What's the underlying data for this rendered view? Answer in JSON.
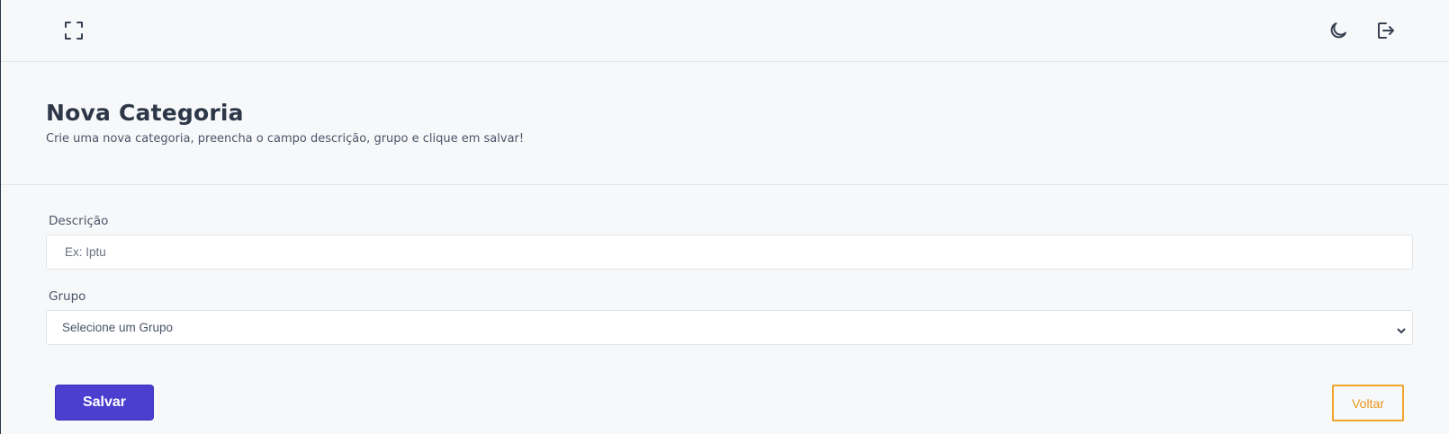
{
  "topbar": {
    "icons": {
      "expand": "fullscreen-icon",
      "theme": "moon-icon",
      "logout": "logout-icon"
    }
  },
  "header": {
    "title": "Nova Categoria",
    "subtitle": "Crie uma nova categoria, preencha o campo descrição, grupo e clique em salvar!"
  },
  "form": {
    "description": {
      "label": "Descrição",
      "value": "",
      "placeholder": "Ex: Iptu"
    },
    "group": {
      "label": "Grupo",
      "selected": "Selecione um Grupo"
    }
  },
  "actions": {
    "save_label": "Salvar",
    "back_label": "Voltar"
  },
  "colors": {
    "primary": "#4b3fd0",
    "warning": "#f0a52a",
    "background": "#f7f8fa"
  }
}
